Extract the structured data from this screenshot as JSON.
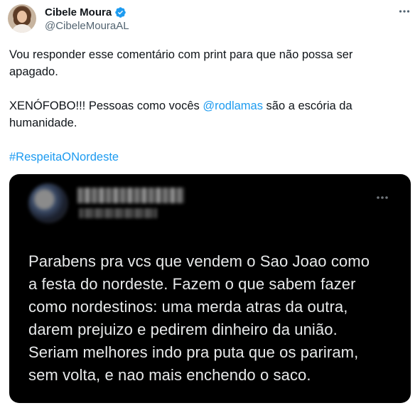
{
  "author": {
    "display_name": "Cibele Moura",
    "handle": "@CibeleMouraAL",
    "verified": true
  },
  "tweet": {
    "lines": [
      "Vou responder esse comentário com print para que não possa ser",
      "apagado."
    ],
    "line3_before": "XENÓFOBO!!! Pessoas como vocês ",
    "mention": "@rodlamas",
    "line3_after": " são a escória da",
    "line4": "humanidade.",
    "hashtag": "#RespeitaONordeste"
  },
  "screenshot": {
    "theme": "dark",
    "author_blurred": true,
    "lines": [
      "Parabens pra vcs que vendem o Sao Joao como",
      "a festa do nordeste. Fazem o que sabem fazer",
      "como nordestinos: uma merda atras da outra,",
      "darem prejuizo e pedirem dinheiro da união.",
      "Seriam melhores indo pra puta que os pariram,",
      "sem volta, e nao mais enchendo o saco."
    ]
  },
  "colors": {
    "link": "#1d9bf0",
    "text": "#0f1419",
    "muted": "#536471",
    "card_bg": "#000000",
    "card_text": "#e7e9ea"
  },
  "icons": {
    "verified": "verified-badge-icon",
    "more": "more-options-icon"
  }
}
